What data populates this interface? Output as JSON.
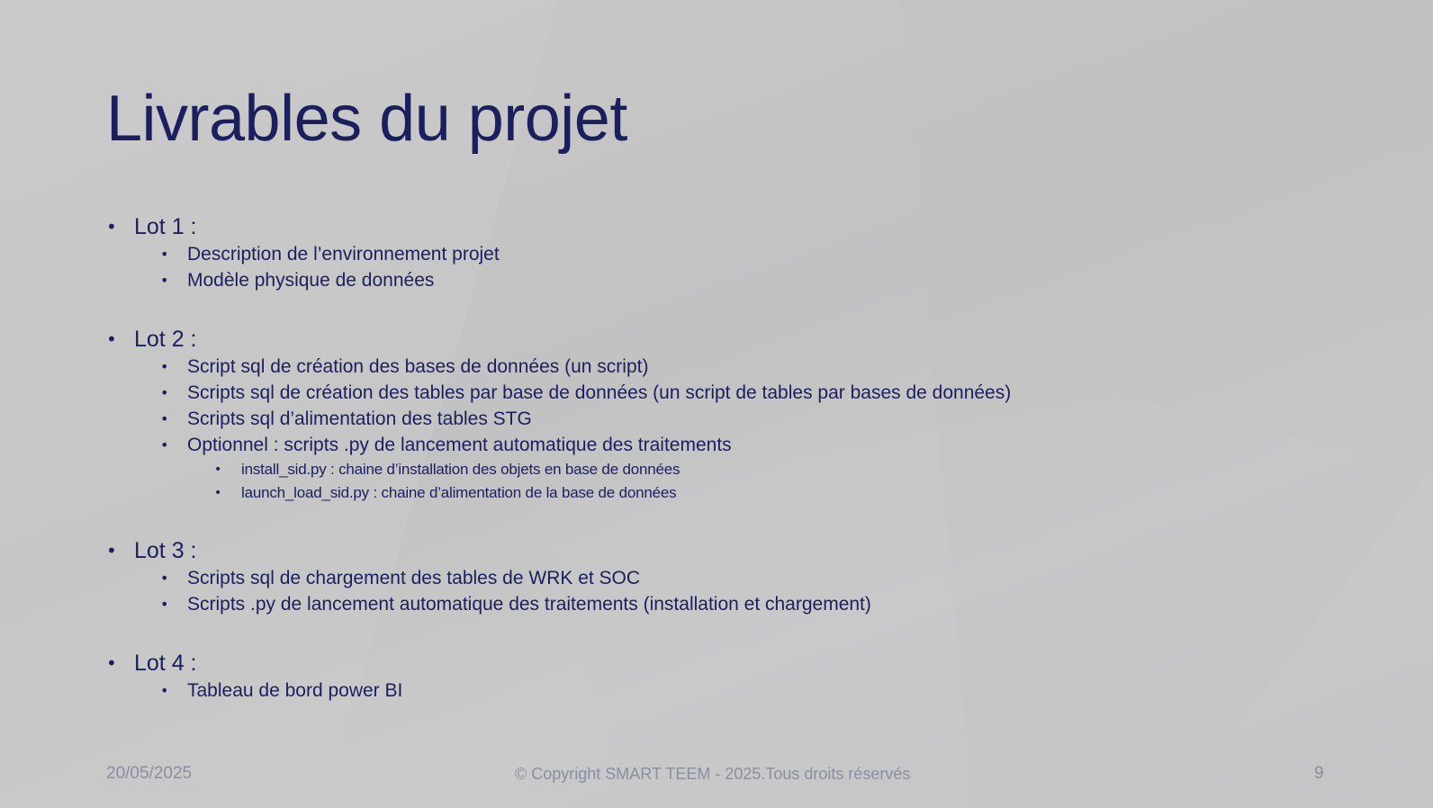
{
  "slide": {
    "title": "Livrables du projet",
    "bullet_glyph": "•",
    "lots": [
      {
        "label": "Lot 1 :",
        "items": [
          {
            "text": "Description de l’environnement projet",
            "sub": []
          },
          {
            "text": "Modèle physique de données",
            "sub": []
          }
        ]
      },
      {
        "label": "Lot 2 :",
        "items": [
          {
            "text": "Script sql de création des bases de données (un script)",
            "sub": []
          },
          {
            "text": "Scripts sql de création des tables par base de données (un script de tables par bases de données)",
            "sub": []
          },
          {
            "text": "Scripts sql d’alimentation des tables STG",
            "sub": []
          },
          {
            "text": "Optionnel : scripts .py de lancement automatique des traitements",
            "sub": [
              "install_sid.py : chaine d’installation des objets en base de données",
              "launch_load_sid.py : chaine d’alimentation de la base de données"
            ]
          }
        ]
      },
      {
        "label": "Lot 3 :",
        "items": [
          {
            "text": "Scripts sql de chargement des tables de WRK et SOC",
            "sub": []
          },
          {
            "text": "Scripts .py de lancement automatique des traitements (installation et chargement)",
            "sub": []
          }
        ]
      },
      {
        "label": "Lot 4 :",
        "items": [
          {
            "text": "Tableau de bord power BI",
            "sub": []
          }
        ]
      }
    ]
  },
  "footer": {
    "date": "20/05/2025",
    "copyright": "© Copyright SMART TEEM - 2025.Tous droits réservés",
    "page_number": "9"
  },
  "colors": {
    "text": "#1c1f5e",
    "footer_text": "#8a8ea0",
    "background": "#c5c5c6"
  }
}
